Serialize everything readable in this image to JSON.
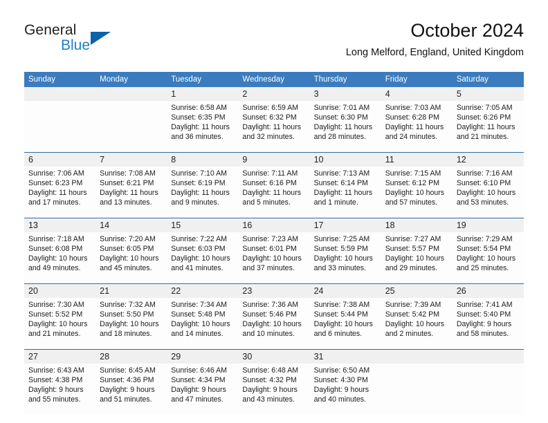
{
  "brand": {
    "name_top": "General",
    "name_bottom": "Blue",
    "accent_color": "#1f7fc4",
    "triangle_color": "#0b63a8"
  },
  "header": {
    "title": "October 2024",
    "subtitle": "Long Melford, England, United Kingdom"
  },
  "calendar": {
    "header_bg": "#3a7cbe",
    "daynum_bg": "#f0f0f0",
    "row_divider_color": "#2e6da4",
    "weekday_headers": [
      "Sunday",
      "Monday",
      "Tuesday",
      "Wednesday",
      "Thursday",
      "Friday",
      "Saturday"
    ],
    "weeks": [
      [
        {
          "day": "",
          "lines": []
        },
        {
          "day": "",
          "lines": []
        },
        {
          "day": "1",
          "lines": [
            "Sunrise: 6:58 AM",
            "Sunset: 6:35 PM",
            "Daylight: 11 hours",
            "and 36 minutes."
          ]
        },
        {
          "day": "2",
          "lines": [
            "Sunrise: 6:59 AM",
            "Sunset: 6:32 PM",
            "Daylight: 11 hours",
            "and 32 minutes."
          ]
        },
        {
          "day": "3",
          "lines": [
            "Sunrise: 7:01 AM",
            "Sunset: 6:30 PM",
            "Daylight: 11 hours",
            "and 28 minutes."
          ]
        },
        {
          "day": "4",
          "lines": [
            "Sunrise: 7:03 AM",
            "Sunset: 6:28 PM",
            "Daylight: 11 hours",
            "and 24 minutes."
          ]
        },
        {
          "day": "5",
          "lines": [
            "Sunrise: 7:05 AM",
            "Sunset: 6:26 PM",
            "Daylight: 11 hours",
            "and 21 minutes."
          ]
        }
      ],
      [
        {
          "day": "6",
          "lines": [
            "Sunrise: 7:06 AM",
            "Sunset: 6:23 PM",
            "Daylight: 11 hours",
            "and 17 minutes."
          ]
        },
        {
          "day": "7",
          "lines": [
            "Sunrise: 7:08 AM",
            "Sunset: 6:21 PM",
            "Daylight: 11 hours",
            "and 13 minutes."
          ]
        },
        {
          "day": "8",
          "lines": [
            "Sunrise: 7:10 AM",
            "Sunset: 6:19 PM",
            "Daylight: 11 hours",
            "and 9 minutes."
          ]
        },
        {
          "day": "9",
          "lines": [
            "Sunrise: 7:11 AM",
            "Sunset: 6:16 PM",
            "Daylight: 11 hours",
            "and 5 minutes."
          ]
        },
        {
          "day": "10",
          "lines": [
            "Sunrise: 7:13 AM",
            "Sunset: 6:14 PM",
            "Daylight: 11 hours",
            "and 1 minute."
          ]
        },
        {
          "day": "11",
          "lines": [
            "Sunrise: 7:15 AM",
            "Sunset: 6:12 PM",
            "Daylight: 10 hours",
            "and 57 minutes."
          ]
        },
        {
          "day": "12",
          "lines": [
            "Sunrise: 7:16 AM",
            "Sunset: 6:10 PM",
            "Daylight: 10 hours",
            "and 53 minutes."
          ]
        }
      ],
      [
        {
          "day": "13",
          "lines": [
            "Sunrise: 7:18 AM",
            "Sunset: 6:08 PM",
            "Daylight: 10 hours",
            "and 49 minutes."
          ]
        },
        {
          "day": "14",
          "lines": [
            "Sunrise: 7:20 AM",
            "Sunset: 6:05 PM",
            "Daylight: 10 hours",
            "and 45 minutes."
          ]
        },
        {
          "day": "15",
          "lines": [
            "Sunrise: 7:22 AM",
            "Sunset: 6:03 PM",
            "Daylight: 10 hours",
            "and 41 minutes."
          ]
        },
        {
          "day": "16",
          "lines": [
            "Sunrise: 7:23 AM",
            "Sunset: 6:01 PM",
            "Daylight: 10 hours",
            "and 37 minutes."
          ]
        },
        {
          "day": "17",
          "lines": [
            "Sunrise: 7:25 AM",
            "Sunset: 5:59 PM",
            "Daylight: 10 hours",
            "and 33 minutes."
          ]
        },
        {
          "day": "18",
          "lines": [
            "Sunrise: 7:27 AM",
            "Sunset: 5:57 PM",
            "Daylight: 10 hours",
            "and 29 minutes."
          ]
        },
        {
          "day": "19",
          "lines": [
            "Sunrise: 7:29 AM",
            "Sunset: 5:54 PM",
            "Daylight: 10 hours",
            "and 25 minutes."
          ]
        }
      ],
      [
        {
          "day": "20",
          "lines": [
            "Sunrise: 7:30 AM",
            "Sunset: 5:52 PM",
            "Daylight: 10 hours",
            "and 21 minutes."
          ]
        },
        {
          "day": "21",
          "lines": [
            "Sunrise: 7:32 AM",
            "Sunset: 5:50 PM",
            "Daylight: 10 hours",
            "and 18 minutes."
          ]
        },
        {
          "day": "22",
          "lines": [
            "Sunrise: 7:34 AM",
            "Sunset: 5:48 PM",
            "Daylight: 10 hours",
            "and 14 minutes."
          ]
        },
        {
          "day": "23",
          "lines": [
            "Sunrise: 7:36 AM",
            "Sunset: 5:46 PM",
            "Daylight: 10 hours",
            "and 10 minutes."
          ]
        },
        {
          "day": "24",
          "lines": [
            "Sunrise: 7:38 AM",
            "Sunset: 5:44 PM",
            "Daylight: 10 hours",
            "and 6 minutes."
          ]
        },
        {
          "day": "25",
          "lines": [
            "Sunrise: 7:39 AM",
            "Sunset: 5:42 PM",
            "Daylight: 10 hours",
            "and 2 minutes."
          ]
        },
        {
          "day": "26",
          "lines": [
            "Sunrise: 7:41 AM",
            "Sunset: 5:40 PM",
            "Daylight: 9 hours",
            "and 58 minutes."
          ]
        }
      ],
      [
        {
          "day": "27",
          "lines": [
            "Sunrise: 6:43 AM",
            "Sunset: 4:38 PM",
            "Daylight: 9 hours",
            "and 55 minutes."
          ]
        },
        {
          "day": "28",
          "lines": [
            "Sunrise: 6:45 AM",
            "Sunset: 4:36 PM",
            "Daylight: 9 hours",
            "and 51 minutes."
          ]
        },
        {
          "day": "29",
          "lines": [
            "Sunrise: 6:46 AM",
            "Sunset: 4:34 PM",
            "Daylight: 9 hours",
            "and 47 minutes."
          ]
        },
        {
          "day": "30",
          "lines": [
            "Sunrise: 6:48 AM",
            "Sunset: 4:32 PM",
            "Daylight: 9 hours",
            "and 43 minutes."
          ]
        },
        {
          "day": "31",
          "lines": [
            "Sunrise: 6:50 AM",
            "Sunset: 4:30 PM",
            "Daylight: 9 hours",
            "and 40 minutes."
          ]
        },
        {
          "day": "",
          "lines": []
        },
        {
          "day": "",
          "lines": []
        }
      ]
    ]
  }
}
